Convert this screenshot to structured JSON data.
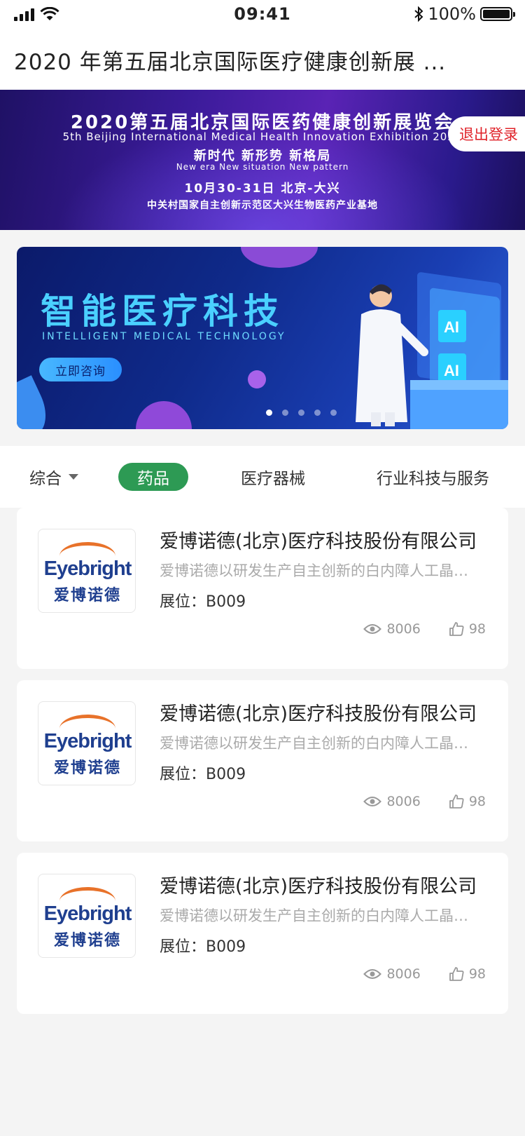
{
  "status_bar": {
    "time": "09:41",
    "battery": "100%"
  },
  "header": {
    "title": "2020 年第五届北京国际医疗健康创新展 ..."
  },
  "top_banner": {
    "line1": "2020第五届北京国际医药健康创新展览会",
    "line2": "5th Beijing International Medical Health Innovation Exhibition 2020",
    "line3": "新时代  新形势  新格局",
    "line4": "New era  New situation  New pattern",
    "line5": "10月30-31日  北京-大兴",
    "line6": "中关村国家自主创新示范区大兴生物医药产业基地",
    "logout_label": "退出登录"
  },
  "promo": {
    "title": "智能医疗科技",
    "subtitle": "INTELLIGENT MEDICAL TECHNOLOGY",
    "button_label": "立即咨询",
    "ai_label": "AI",
    "dots": 5,
    "active_dot": 1
  },
  "tabs": [
    {
      "label": "综合"
    },
    {
      "label": "药品",
      "active": true
    },
    {
      "label": "医疗器械"
    },
    {
      "label": "行业科技与服务"
    }
  ],
  "cards": [
    {
      "logo_en": "Eyebright",
      "logo_cn": "爱博诺德",
      "title": "爱博诺德(北京)医疗科技股份有限公司",
      "description": "爱博诺德以研发生产自主创新的白内障人工晶状体",
      "booth": "展位：B009",
      "views": "8006",
      "likes": "98"
    },
    {
      "logo_en": "Eyebright",
      "logo_cn": "爱博诺德",
      "title": "爱博诺德(北京)医疗科技股份有限公司",
      "description": "爱博诺德以研发生产自主创新的白内障人工晶状体",
      "booth": "展位：B009",
      "views": "8006",
      "likes": "98"
    },
    {
      "logo_en": "Eyebright",
      "logo_cn": "爱博诺德",
      "title": "爱博诺德(北京)医疗科技股份有限公司",
      "description": "爱博诺德以研发生产自主创新的白内障人工晶状体",
      "booth": "展位：B009",
      "views": "8006",
      "likes": "98"
    }
  ],
  "colors": {
    "accent_green": "#2d9a54",
    "logout_red": "#e0232a",
    "logo_blue": "#1f3f8f",
    "logo_orange": "#e8722a"
  }
}
